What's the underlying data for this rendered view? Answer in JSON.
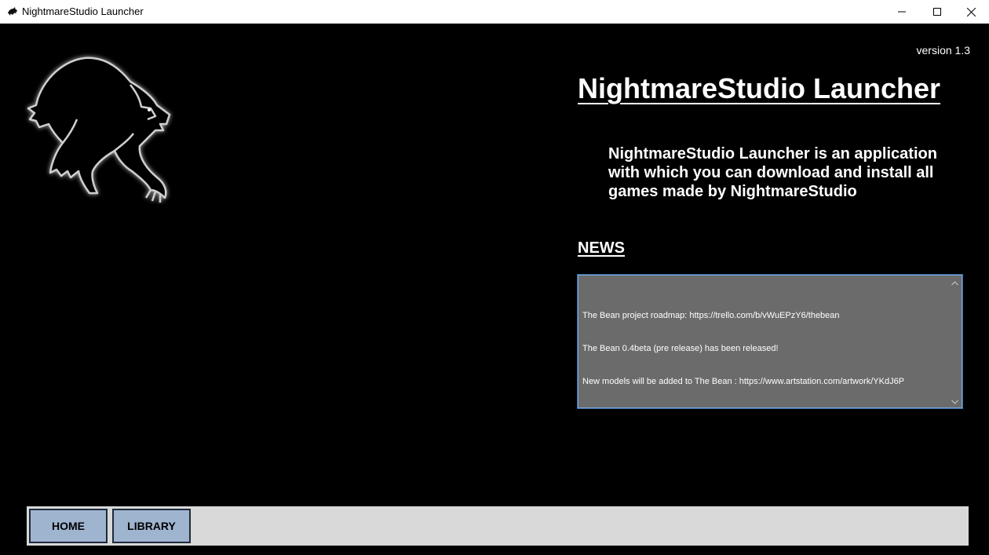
{
  "window": {
    "title": "NightmareStudio Launcher"
  },
  "header": {
    "version": "version 1.3",
    "title": "NightmareStudio Launcher",
    "description": "NightmareStudio Launcher is an application with which you can download and install all games made by NightmareStudio"
  },
  "news": {
    "heading": "NEWS",
    "lines": [
      "The Bean project roadmap: https://trello.com/b/vWuEPzY6/thebean",
      "The Bean 0.4beta (pre release) has been released!",
      "New models will be added to The Bean : https://www.artstation.com/artwork/YKdJ6P"
    ]
  },
  "nav": {
    "home_label": "HOME",
    "library_label": "LIBRARY"
  },
  "colors": {
    "background": "#000000",
    "news_box": "#6b6b6b",
    "nav_bar": "#d9d9d9",
    "nav_button": "#9fb4cf"
  },
  "icons": {
    "app": "wolf-icon",
    "logo": "wolf-logo",
    "minimize": "minimize-icon",
    "maximize": "maximize-icon",
    "close": "close-icon"
  }
}
